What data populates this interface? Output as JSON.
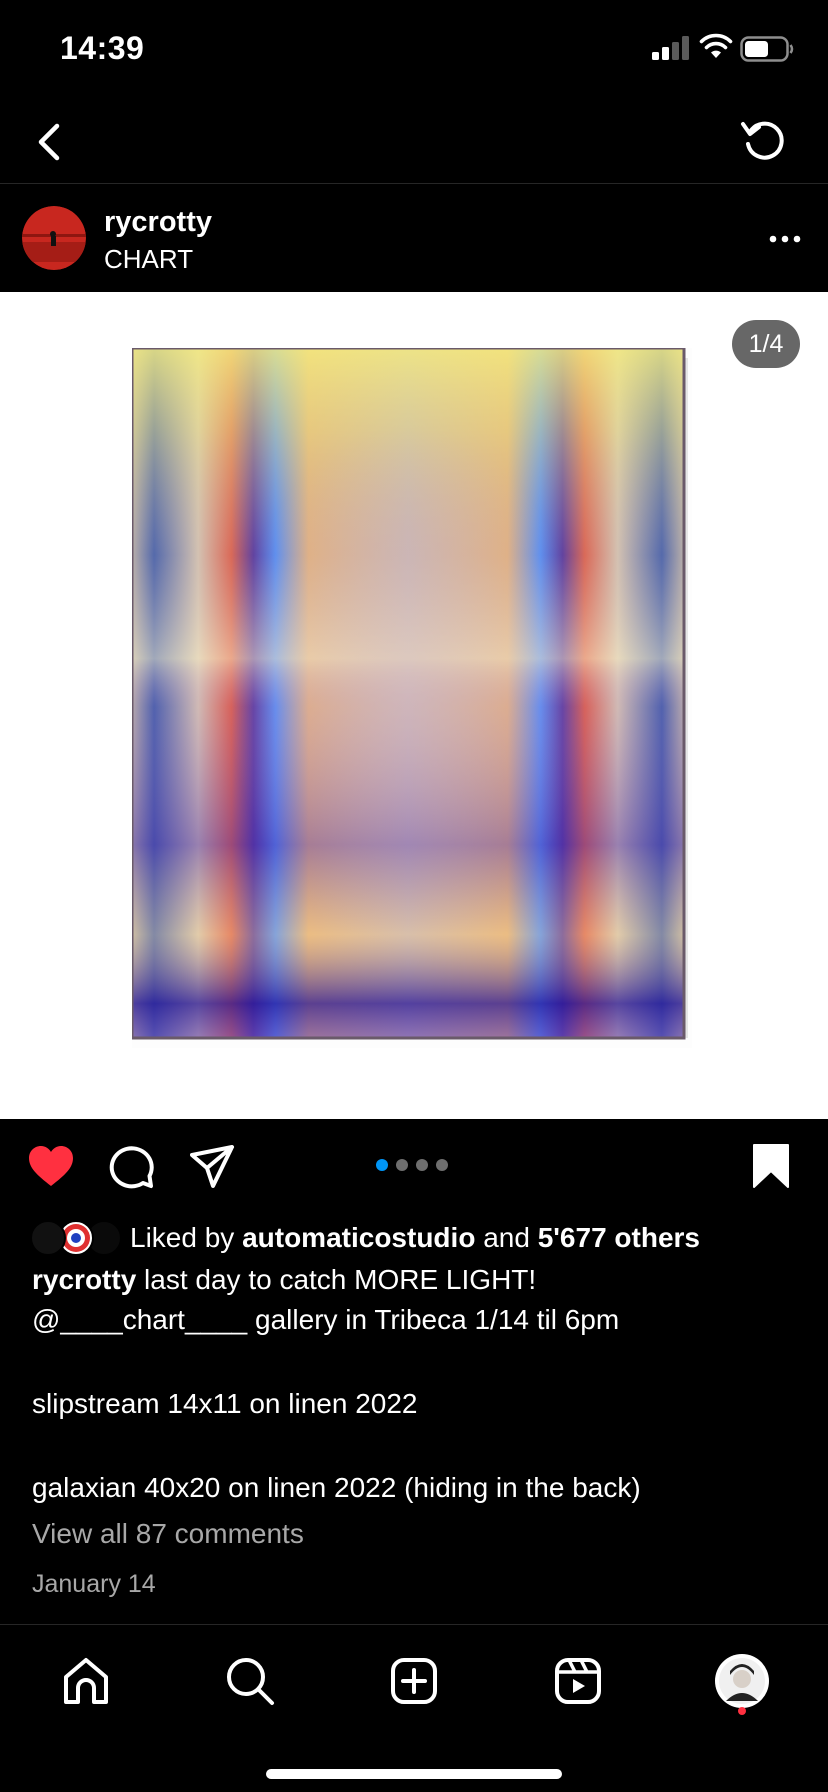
{
  "status_bar": {
    "time": "14:39"
  },
  "post": {
    "username": "rycrotty",
    "location": "CHART",
    "image_counter": "1/4",
    "carousel_total": 4,
    "carousel_active": 1
  },
  "likes": {
    "prefix": "Liked by ",
    "user": "automaticostudio",
    "conjunction": " and ",
    "others": "5'677 others"
  },
  "caption": {
    "username": "rycrotty",
    "line1": " last day to catch MORE LIGHT!",
    "line2": "@____chart____ gallery in Tribeca 1/14 til 6pm",
    "line3": "slipstream 14x11 on linen 2022",
    "line4": "galaxian 40x20 on linen 2022 (hiding in the back)"
  },
  "view_comments": "View all 87 comments",
  "date": "January 14",
  "colors": {
    "like": "#ff3040",
    "carousel_active": "#0095f6",
    "secondary_text": "#a8a8a8"
  },
  "icons": [
    "back-icon",
    "refresh-icon",
    "more-icon",
    "heart-icon",
    "comment-icon",
    "share-icon",
    "bookmark-icon",
    "home-icon",
    "search-icon",
    "create-icon",
    "reels-icon",
    "profile-avatar"
  ]
}
